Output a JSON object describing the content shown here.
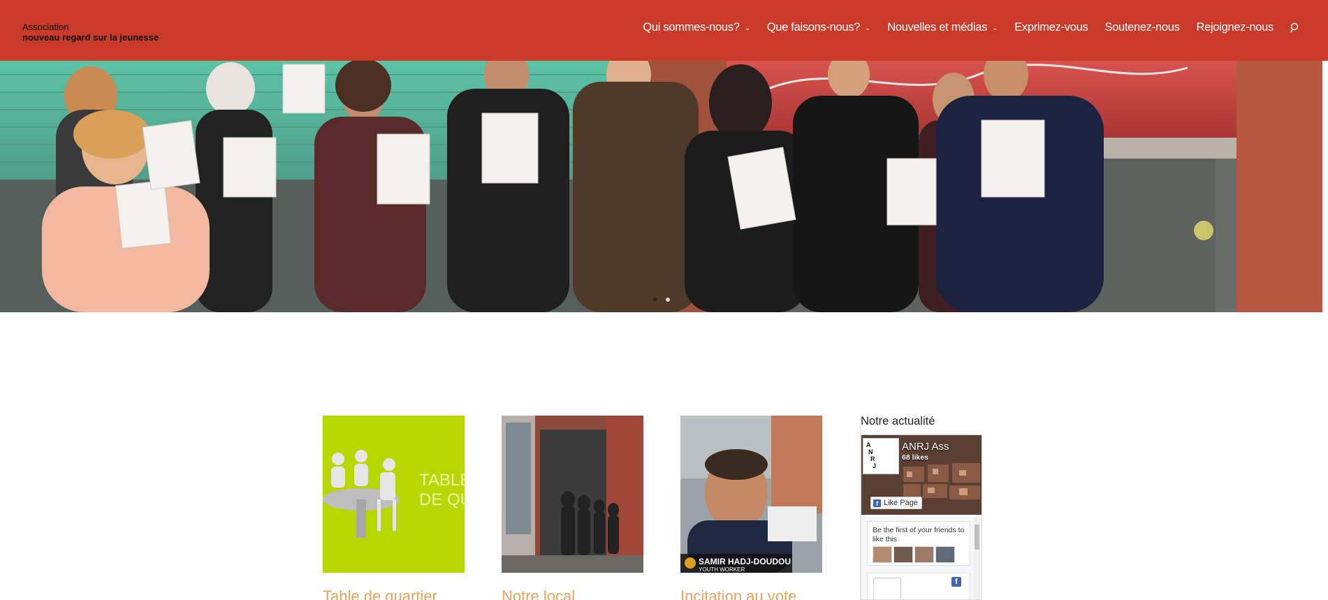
{
  "header": {
    "logo_line1": "Association",
    "logo_line2": "nouveau regard sur la jeunesse",
    "background_color": "#c93a29",
    "nav": [
      {
        "label": "Qui sommes-nous?",
        "has_dropdown": true
      },
      {
        "label": "Que faisons-nous?",
        "has_dropdown": true
      },
      {
        "label": "Nouvelles et médias",
        "has_dropdown": true
      },
      {
        "label": "Exprimez-vous",
        "has_dropdown": false
      },
      {
        "label": "Soutenez-nous",
        "has_dropdown": false
      },
      {
        "label": "Rejoignez-nous",
        "has_dropdown": false
      }
    ],
    "search_icon": "search-icon"
  },
  "hero": {
    "slides_count": 2,
    "active_slide": 2
  },
  "cards": [
    {
      "title": "Table de quartier",
      "thumb_text_1": "TABLES",
      "thumb_text_2": "DE QUA"
    },
    {
      "title": "Notre local"
    },
    {
      "title": "Incitation au vote",
      "caption_name": "SAMIR HADJ-DOUDOU",
      "caption_role": "YOUTH WORKER"
    }
  ],
  "sidebar": {
    "title": "Notre actualité",
    "facebook": {
      "page_name": "ANRJ Ass",
      "likes": "68 likes",
      "like_button": "Like Page",
      "friends_text": "Be the first of your friends to like this",
      "brand_color": "#4267b2"
    }
  },
  "accent_title_color": "#e8a35a"
}
